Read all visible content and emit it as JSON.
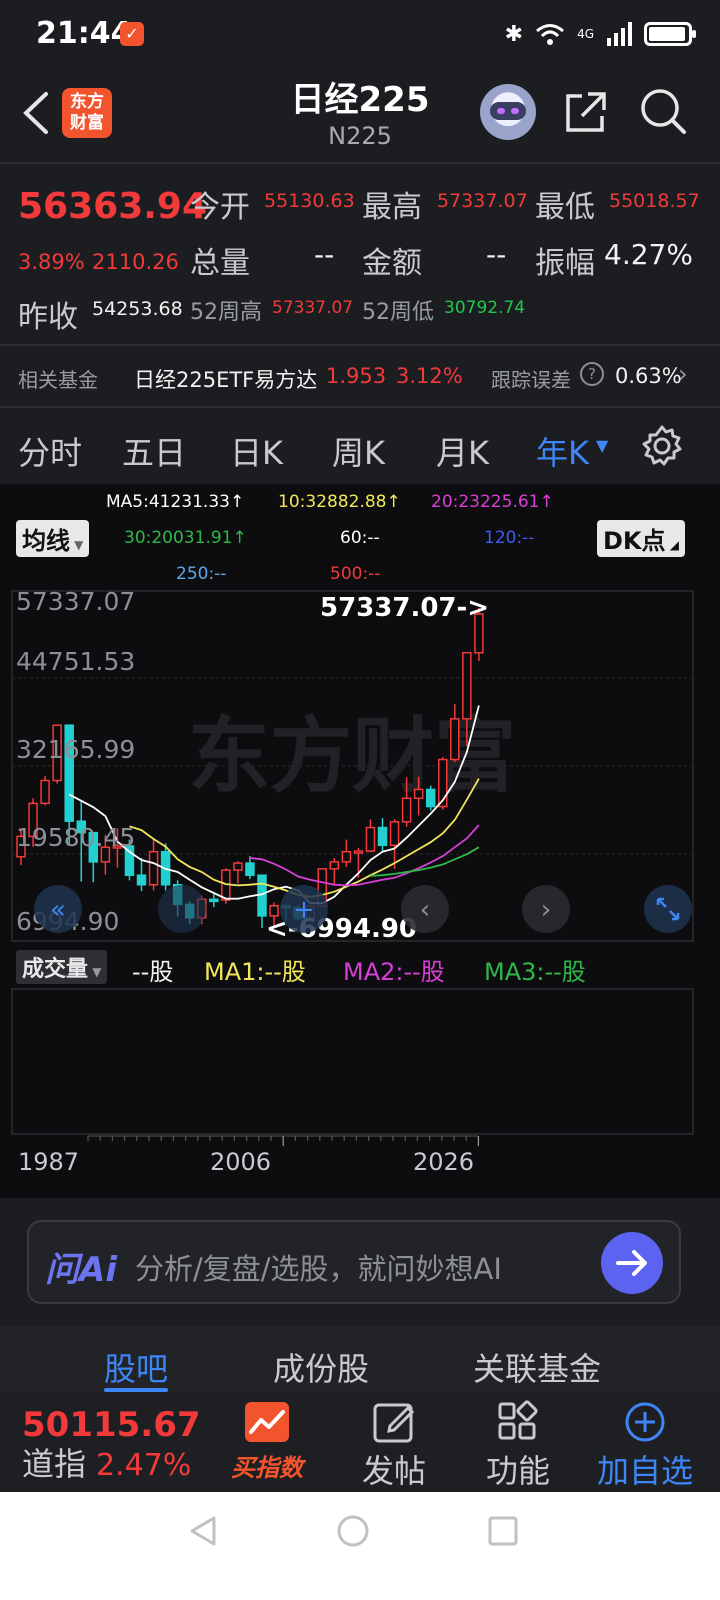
{
  "status": {
    "time": "21:44",
    "network": "4G"
  },
  "header": {
    "title": "日经225",
    "subtitle": "N225",
    "logo_text": "东方财富"
  },
  "quote": {
    "price": "56363.94",
    "change_pct": "3.89%",
    "change_abs": "2110.26",
    "open_label": "今开",
    "open": "55130.63",
    "high_label": "最高",
    "high": "57337.07",
    "low_label": "最低",
    "low": "55018.57",
    "volume_label": "总量",
    "volume": "--",
    "amount_label": "金额",
    "amount": "--",
    "amplitude_label": "振幅",
    "amplitude": "4.27%",
    "prev_close_label": "昨收",
    "prev_close": "54253.68",
    "w52_high_label": "52周高",
    "w52_high": "57337.07",
    "w52_low_label": "52周低",
    "w52_low": "30792.74"
  },
  "fund": {
    "label": "相关基金",
    "name": "日经225ETF易方达",
    "price": "1.953",
    "change": "3.12%",
    "tracking_label": "跟踪误差",
    "tracking_value": "0.63%"
  },
  "tabs": [
    "分时",
    "五日",
    "日K",
    "周K",
    "月K",
    "年K"
  ],
  "active_tab": "年K",
  "ma": {
    "ma5": "MA5:41231.33↑",
    "ma10": "10:32882.88↑",
    "ma20": "20:23225.61↑",
    "ma30": "30:20031.91↑",
    "ma60": "60:--",
    "ma120": "120:--",
    "ma250": "250:--",
    "ma500": "500:--",
    "selector": "均线",
    "dk_label": "DK点"
  },
  "colors": {
    "up": "#f23a3a",
    "down": "#22d0d0",
    "ma5": "#ffffff",
    "ma10": "#f2e65a",
    "ma20": "#d83fd8",
    "ma30": "#2fb84a",
    "ma120": "#3c5cf0",
    "ma250": "#5aa8f0",
    "accent": "#3e86f5"
  },
  "chart_data": {
    "type": "candlestick",
    "y_ticks": [
      "57337.07",
      "44751.53",
      "32165.99",
      "19580.45",
      "6994.90"
    ],
    "ylim": [
      6994.9,
      57337.07
    ],
    "high_marker": "57337.07->",
    "low_marker": "<-6994.90",
    "x_ticks": [
      "1987",
      "2006",
      "2026"
    ],
    "watermark": "东方财富",
    "candles": [
      {
        "o": 18200,
        "c": 21400,
        "h": 22600,
        "l": 16900
      },
      {
        "o": 21400,
        "c": 26600,
        "h": 27400,
        "l": 19800
      },
      {
        "o": 26600,
        "c": 30200,
        "h": 30900,
        "l": 26300
      },
      {
        "o": 30200,
        "c": 38900,
        "h": 38950,
        "l": 29700
      },
      {
        "o": 38900,
        "c": 23800,
        "h": 38900,
        "l": 20200
      },
      {
        "o": 23800,
        "c": 22000,
        "h": 27100,
        "l": 14300
      },
      {
        "o": 22000,
        "c": 17400,
        "h": 21100,
        "l": 14200
      },
      {
        "o": 17400,
        "c": 19700,
        "h": 21600,
        "l": 15400
      },
      {
        "o": 19700,
        "c": 19900,
        "h": 22700,
        "l": 16500
      },
      {
        "o": 19900,
        "c": 15300,
        "h": 20900,
        "l": 14500
      },
      {
        "o": 15300,
        "c": 13800,
        "h": 18000,
        "l": 12800
      },
      {
        "o": 13800,
        "c": 19000,
        "h": 21000,
        "l": 12900
      },
      {
        "o": 19000,
        "c": 13800,
        "h": 20300,
        "l": 12900
      },
      {
        "o": 13800,
        "c": 10700,
        "h": 14500,
        "l": 8800
      },
      {
        "o": 10700,
        "c": 8600,
        "h": 11200,
        "l": 7600
      },
      {
        "o": 8600,
        "c": 11500,
        "h": 12100,
        "l": 7600
      },
      {
        "o": 11500,
        "c": 11400,
        "h": 12300,
        "l": 10300
      },
      {
        "o": 11400,
        "c": 16100,
        "h": 16400,
        "l": 10800
      },
      {
        "o": 16100,
        "c": 17200,
        "h": 17500,
        "l": 14000
      },
      {
        "o": 17200,
        "c": 15300,
        "h": 18300,
        "l": 14700
      },
      {
        "o": 15300,
        "c": 8900,
        "h": 15200,
        "l": 6995
      },
      {
        "o": 8900,
        "c": 10500,
        "h": 11000,
        "l": 7100
      },
      {
        "o": 10500,
        "c": 10200,
        "h": 10900,
        "l": 8200
      },
      {
        "o": 10200,
        "c": 8500,
        "h": 10600,
        "l": 8100
      },
      {
        "o": 8500,
        "c": 10400,
        "h": 10700,
        "l": 8300
      },
      {
        "o": 10400,
        "c": 16300,
        "h": 16300,
        "l": 10400
      },
      {
        "o": 16300,
        "c": 17400,
        "h": 18000,
        "l": 13900
      },
      {
        "o": 17400,
        "c": 19000,
        "h": 20900,
        "l": 16600
      },
      {
        "o": 19000,
        "c": 19100,
        "h": 19600,
        "l": 14900
      },
      {
        "o": 19100,
        "c": 22800,
        "h": 24100,
        "l": 18900
      },
      {
        "o": 22800,
        "c": 20000,
        "h": 24300,
        "l": 19100
      },
      {
        "o": 20000,
        "c": 23700,
        "h": 24100,
        "l": 16300
      },
      {
        "o": 23700,
        "c": 27400,
        "h": 30700,
        "l": 22900
      },
      {
        "o": 27400,
        "c": 28800,
        "h": 30800,
        "l": 24700
      },
      {
        "o": 28800,
        "c": 26100,
        "h": 29400,
        "l": 25500
      },
      {
        "o": 26100,
        "c": 33500,
        "h": 33900,
        "l": 25600
      },
      {
        "o": 33500,
        "c": 39900,
        "h": 42200,
        "l": 33100
      },
      {
        "o": 39900,
        "c": 50300,
        "h": 50300,
        "l": 35600
      },
      {
        "o": 50300,
        "c": 56400,
        "h": 57337,
        "l": 49000
      }
    ],
    "ma5": [
      null,
      null,
      null,
      null,
      28000,
      27000,
      26000,
      24600,
      20600,
      19000,
      17700,
      17200,
      16300,
      15800,
      14600,
      13400,
      12500,
      11600,
      11600,
      12000,
      12300,
      13100,
      13500,
      12900,
      10900,
      10900,
      11900,
      13800,
      15600,
      17700,
      19000,
      19500,
      21200,
      23100,
      25000,
      27100,
      30000,
      34700,
      42000
    ],
    "ma10": [
      null,
      null,
      null,
      null,
      null,
      null,
      null,
      null,
      null,
      23000,
      22400,
      21000,
      19800,
      17800,
      16600,
      15800,
      14600,
      13900,
      13700,
      13800,
      14000,
      13500,
      12900,
      12200,
      11900,
      12200,
      12700,
      13500,
      14300,
      15300,
      16200,
      17200,
      18300,
      19400,
      20500,
      21900,
      24000,
      27200,
      30500
    ],
    "ma20": [
      null,
      null,
      null,
      null,
      null,
      null,
      null,
      null,
      null,
      null,
      null,
      null,
      null,
      null,
      null,
      null,
      null,
      null,
      null,
      18000,
      17800,
      17100,
      16200,
      15100,
      14600,
      14200,
      13800,
      13700,
      13800,
      14200,
      14600,
      14900,
      15600,
      16400,
      17300,
      18300,
      19700,
      21100,
      23200
    ],
    "ma30": [
      null,
      null,
      null,
      null,
      null,
      null,
      null,
      null,
      null,
      null,
      null,
      null,
      null,
      null,
      null,
      null,
      null,
      null,
      null,
      null,
      null,
      null,
      null,
      null,
      null,
      null,
      null,
      null,
      null,
      15200,
      15300,
      15500,
      15800,
      16100,
      16500,
      17000,
      17800,
      18600,
      19700
    ]
  },
  "volume": {
    "selector": "成交量",
    "value": "--股",
    "ma1": "MA1:--股",
    "ma2": "MA2:--股",
    "ma3": "MA3:--股"
  },
  "ai": {
    "logo": "问Ai",
    "placeholder": "分析/复盘/选股，就问妙想AI"
  },
  "bottom_tabs": [
    "股吧",
    "成份股",
    "关联基金"
  ],
  "active_bottom_tab": "股吧",
  "ticker": {
    "value": "50115.67",
    "name": "道指",
    "change": "2.47%"
  },
  "actions": {
    "buy": "买指数",
    "post": "发帖",
    "func": "功能",
    "add": "加自选"
  }
}
